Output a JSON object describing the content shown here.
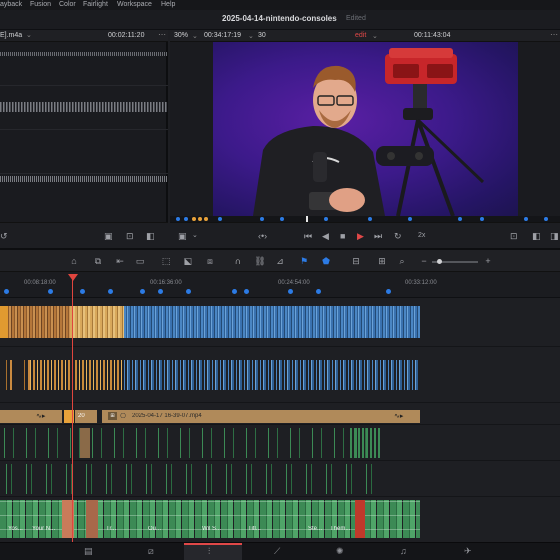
{
  "menu": {
    "items": [
      "ayback",
      "Fusion",
      "Color",
      "Fairlight",
      "Workspace",
      "Help"
    ]
  },
  "title": {
    "project": "2025-04-14-nintendo-consoles",
    "status": "Edited"
  },
  "source_viewer": {
    "clip_name": "E].m4a",
    "timecode": "00:02:11:20",
    "more_icon": "ellipsis-icon"
  },
  "record_viewer": {
    "zoom": "30%",
    "timecode": "00:34:17:19",
    "fps": "30",
    "mode": "edit",
    "duration": "00:11:43:04",
    "speed": "2x"
  },
  "ruler": {
    "labels": [
      "00:08:18:00",
      "00:16:36:00",
      "00:24:54:00",
      "00:33:12:00"
    ]
  },
  "clips": {
    "compound_a": "20",
    "compound_b": "2025-04-17 16-39-07.mp4",
    "audio_labels": [
      "Yos...",
      "Your N...",
      "Tr...",
      "Ou...",
      "Wil S...",
      "Titl...",
      "Ste...",
      "Them..."
    ]
  },
  "colors": {
    "accent_red": "#e04848",
    "marker_blue": "#2c7be5",
    "video_blue": "#4a86c4",
    "video_orange": "#c8843a",
    "audio_green": "#3c8a55",
    "compound_tan": "#b08a5a"
  },
  "pages": [
    "media-icon",
    "cut-icon",
    "edit-icon",
    "fusion-icon",
    "color-icon",
    "fairlight-icon",
    "deliver-icon"
  ]
}
